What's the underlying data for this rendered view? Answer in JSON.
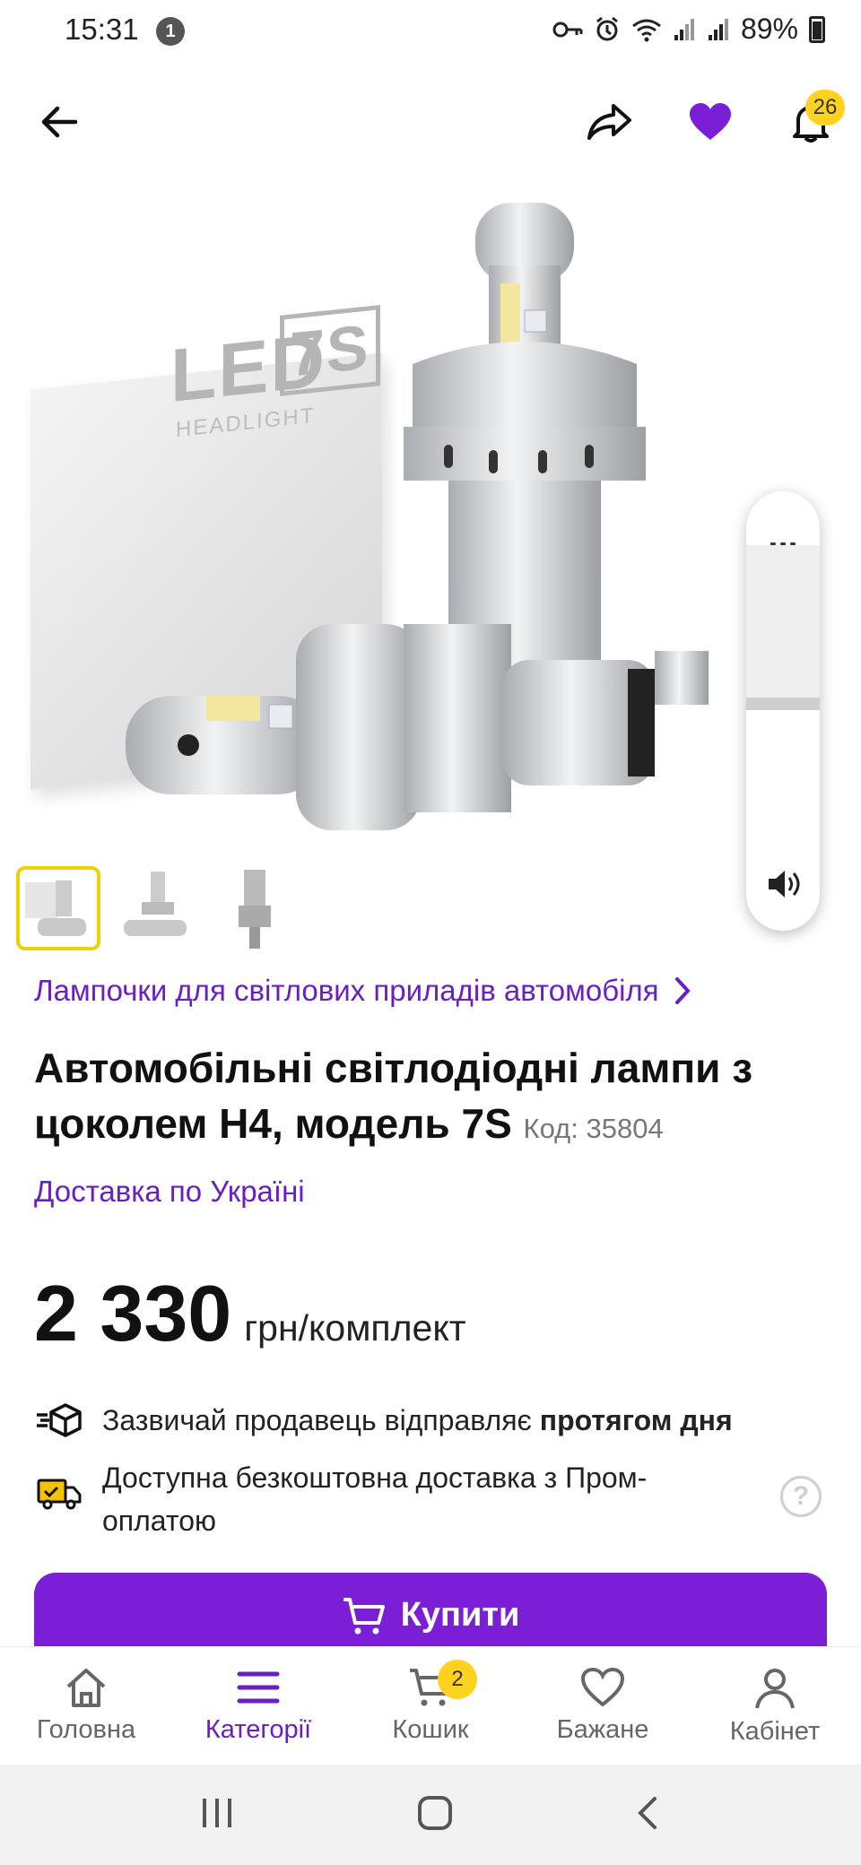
{
  "status_bar": {
    "time": "15:31",
    "notification_count": "1",
    "battery": "89%"
  },
  "header": {
    "notification_badge": "26"
  },
  "product_image": {
    "box_brand": "LED",
    "box_model": "7S",
    "box_subtitle": "HEADLIGHT",
    "video_menu": "..."
  },
  "thumbnails": [
    {
      "label": "thumb-1",
      "active": true
    },
    {
      "label": "thumb-2",
      "active": false
    },
    {
      "label": "thumb-3",
      "active": false
    }
  ],
  "category": {
    "label": "Лампочки для світлових приладів автомобіля"
  },
  "product": {
    "title": "Автомобільні світлодіодні лампи з цоколем H4, модель 7S",
    "code": "Код: 35804",
    "delivery": "Доставка по Україні",
    "price": "2 330",
    "price_unit": "грн/комплект"
  },
  "info": {
    "shipping_prefix": "Зазвичай продавець відправляє ",
    "shipping_bold": "протягом дня",
    "free_delivery": "Доступна безкоштовна доставка з Пром-оплатою",
    "help": "?"
  },
  "buy_button": {
    "label": "Купити"
  },
  "bottom_nav": {
    "items": [
      {
        "label": "Головна",
        "icon": "home-icon"
      },
      {
        "label": "Категорії",
        "icon": "menu-icon"
      },
      {
        "label": "Кошик",
        "icon": "cart-icon"
      },
      {
        "label": "Бажане",
        "icon": "heart-icon"
      },
      {
        "label": "Кабінет",
        "icon": "user-icon"
      }
    ],
    "active": "Категорії",
    "cart_badge": "2"
  },
  "colors": {
    "accent": "#7b1fd6",
    "link": "#6a1fc2",
    "badge": "#ffd21f"
  }
}
